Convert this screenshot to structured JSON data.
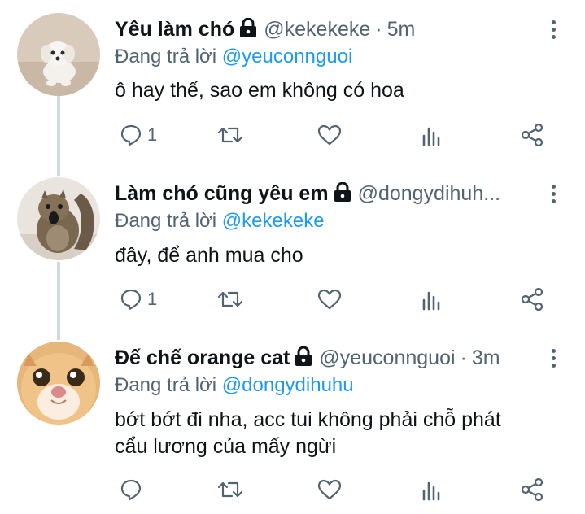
{
  "tweets": [
    {
      "name": "Yêu làm chó",
      "handle": "@kekekeke",
      "dot": "·",
      "time": "5m",
      "reply_prefix": "Đang trả lời ",
      "reply_to": "@yeuconnguoi",
      "text_lines": [
        "ô hay thế, sao em không có hoa"
      ],
      "reply_count": "1",
      "avatar": "white-puppy"
    },
    {
      "name": "Làm chó cũng yêu em",
      "handle": "@dongydihuh...",
      "dot": "",
      "time": "",
      "reply_prefix": "Đang trả lời ",
      "reply_to": "@kekekeke",
      "text_lines": [
        "đây, để anh mua cho"
      ],
      "reply_count": "1",
      "avatar": "squirrel"
    },
    {
      "name": "Đế chế orange cat",
      "handle": "@yeuconnguoi",
      "dot": "·",
      "time": "3m",
      "reply_prefix": "Đang trả lời ",
      "reply_to": "@dongydihuhu",
      "text_lines": [
        "bớt bớt đi nha, acc tui không phải chỗ phát",
        "cẩu lương của mấy ngừi"
      ],
      "reply_count": "",
      "avatar": "orange-cat"
    }
  ],
  "colors": {
    "text": "#0f1419",
    "secondary": "#536471",
    "mention": "#1d9bf0",
    "thread_line": "#cfd9de"
  }
}
